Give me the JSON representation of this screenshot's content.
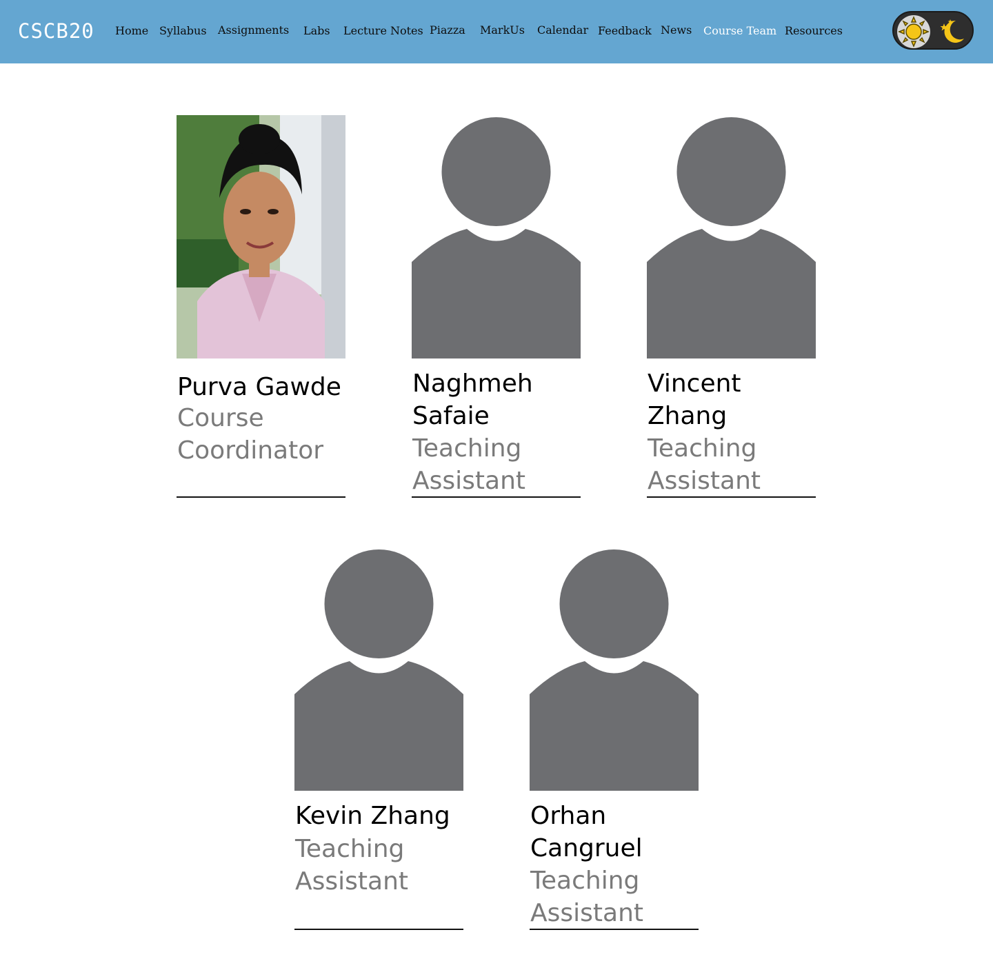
{
  "header": {
    "logo": "CSCB20",
    "nav": [
      {
        "label": "Home",
        "active": false
      },
      {
        "label": "Syllabus",
        "active": false
      },
      {
        "label": "Assignments",
        "active": false
      },
      {
        "label": "Labs",
        "active": false
      },
      {
        "label": "Lecture Notes",
        "active": false
      },
      {
        "label": "Piazza",
        "active": false
      },
      {
        "label": "MarkUs",
        "active": false
      },
      {
        "label": "Calendar",
        "active": false
      },
      {
        "label": "Feedback",
        "active": false
      },
      {
        "label": "News",
        "active": false
      },
      {
        "label": "Course Team",
        "active": true
      },
      {
        "label": "Resources",
        "active": false
      }
    ],
    "theme_toggle": {
      "light_icon": "sun-icon",
      "dark_icon": "moon-stars-icon"
    }
  },
  "team": [
    {
      "name": "Purva Gawde",
      "role": "Course Coordinator",
      "photo": "portrait-photo"
    },
    {
      "name": "Naghmeh Safaie",
      "role": "Teaching Assistant",
      "photo": "default-avatar-icon"
    },
    {
      "name": "Vincent Zhang",
      "role": "Teaching Assistant",
      "photo": "default-avatar-icon"
    },
    {
      "name": "Kevin Zhang",
      "role": "Teaching Assistant",
      "photo": "default-avatar-icon"
    },
    {
      "name": "Orhan Cangruel",
      "role": "Teaching Assistant",
      "photo": "default-avatar-icon"
    }
  ],
  "colors": {
    "header_bg": "#64a6d1",
    "active_nav": "#ffffff",
    "avatar_gray": "#6d6e71",
    "role_text": "#7a7a7a"
  }
}
